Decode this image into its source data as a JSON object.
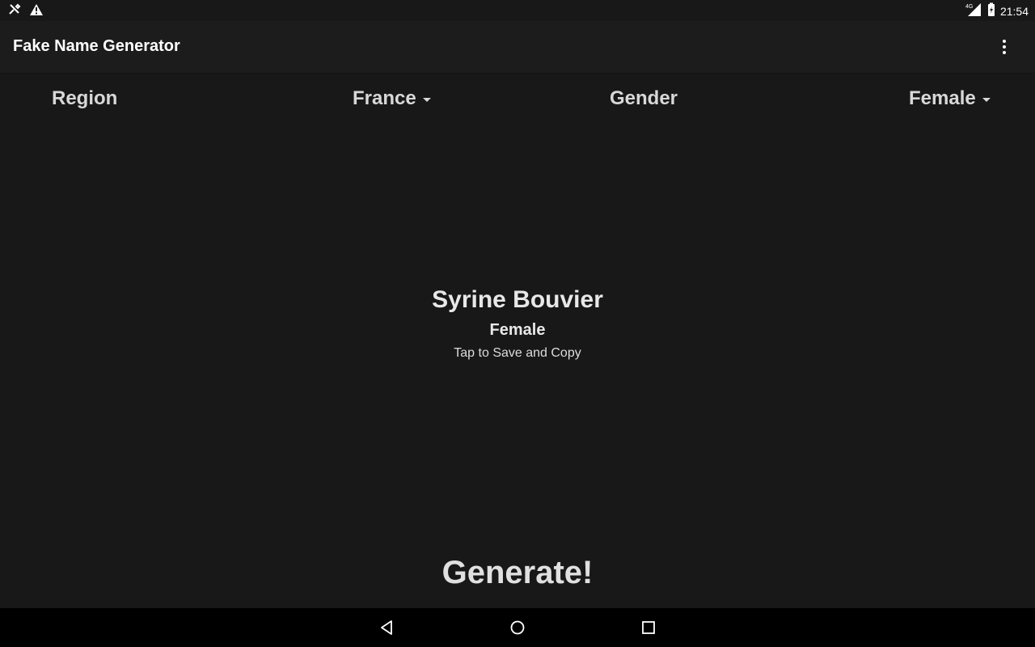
{
  "status_bar": {
    "time": "21:54",
    "network": "4G",
    "icons": [
      "tools-icon",
      "warning-icon",
      "signal-icon",
      "battery-charging-icon"
    ]
  },
  "app_bar": {
    "title": "Fake Name Generator",
    "overflow_icon": "more-vert-icon"
  },
  "selectors": {
    "region_label": "Region",
    "region_value": "France",
    "gender_label": "Gender",
    "gender_value": "Female"
  },
  "result": {
    "name": "Syrine Bouvier",
    "gender": "Female",
    "hint": "Tap to Save and Copy"
  },
  "generate": {
    "label": "Generate!"
  },
  "nav_bar": {
    "icons": [
      "back-icon",
      "home-icon",
      "recents-icon"
    ]
  },
  "colors": {
    "background": "#181818",
    "app_bar": "#1c1c1c",
    "text": "#e6e6e6",
    "nav_bar": "#000000"
  }
}
